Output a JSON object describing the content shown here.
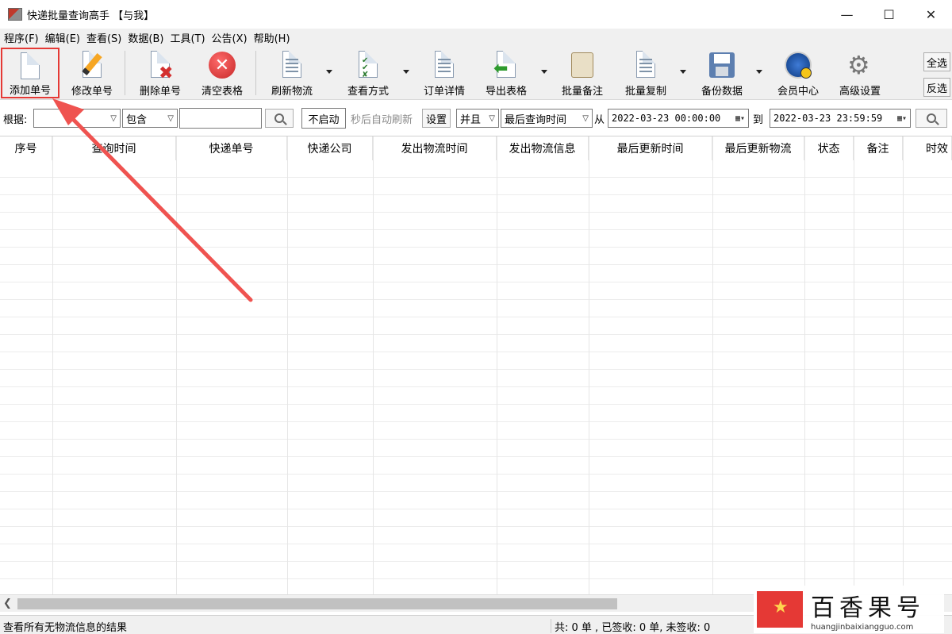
{
  "window": {
    "title": "快递批量查询高手 【与我】",
    "minimize": "—",
    "maximize": "☐",
    "close": "✕"
  },
  "menu": [
    "程序(F)",
    "编辑(E)",
    "查看(S)",
    "数据(B)",
    "工具(T)",
    "公告(X)",
    "帮助(H)"
  ],
  "toolbar": {
    "add": "添加单号",
    "edit": "修改单号",
    "delete": "删除单号",
    "clear": "清空表格",
    "refresh": "刷新物流",
    "view_mode": "查看方式",
    "order_detail": "订单详情",
    "export": "导出表格",
    "batch_note": "批量备注",
    "batch_copy": "批量复制",
    "backup": "备份数据",
    "member": "会员中心",
    "advanced": "高级设置",
    "select_all": "全选",
    "invert": "反选"
  },
  "filter": {
    "basis_label": "根据:",
    "basis_value": "",
    "match_value": "包含",
    "keyword": "",
    "auto_refresh": "不启动",
    "auto_refresh_suffix": "秒后自动刷新",
    "settings": "设置",
    "logic": "并且",
    "time_field": "最后查询时间",
    "from_label": "从",
    "from_value": "2022-03-23 00:00:00",
    "to_label": "到",
    "to_value": "2022-03-23 23:59:59"
  },
  "table": {
    "columns": [
      "序号",
      "查询时间",
      "快递单号",
      "快递公司",
      "发出物流时间",
      "发出物流信息",
      "最后更新时间",
      "最后更新物流",
      "状态",
      "备注",
      "时效"
    ]
  },
  "status": {
    "left": "查看所有无物流信息的结果",
    "right": "共: 0 单 , 已签收:  0 单, 未签收:  0"
  },
  "watermark": {
    "name": "百香果号",
    "url": "huangjinbaixiangguo.com"
  },
  "colors": {
    "highlight": "#e53935",
    "annotation_arrow": "#ef5350"
  }
}
